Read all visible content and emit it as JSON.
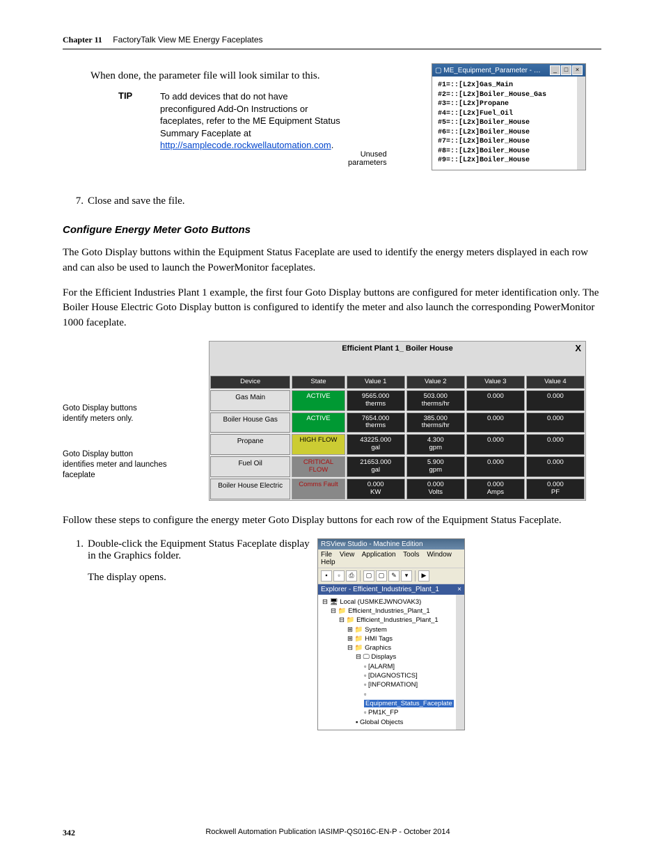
{
  "header": {
    "chapter": "Chapter 11",
    "title": "FactoryTalk View ME Energy Faceplates"
  },
  "intro": "When done, the parameter file will look similar to this.",
  "tip": {
    "label": "TIP",
    "body": "To add devices that do not have preconfigured Add-On Instructions or faceplates, refer to the ME Equipment Status Summary Faceplate at ",
    "link": "http://samplecode.rockwellautomation.com",
    "tail": "."
  },
  "unused": {
    "l1": "Unused",
    "l2": "parameters"
  },
  "param_window": {
    "title": "ME_Equipment_Parameter - …",
    "lines": [
      "#1=::[L2x]Gas_Main",
      "#2=::[L2x]Boiler_House_Gas",
      "#3=::[L2x]Propane",
      "#4=::[L2x]Fuel_Oil",
      "#5=::[L2x]Boiler_House",
      "#6=::[L2x]Boiler_House",
      "#7=::[L2x]Boiler_House",
      "#8=::[L2x]Boiler_House",
      "#9=::[L2x]Boiler_House"
    ]
  },
  "step7": {
    "num": "7.",
    "text": "Close and save the file."
  },
  "section": "Configure Energy Meter Goto Buttons",
  "para1": "The Goto Display buttons within the Equipment Status Faceplate are used to identify the energy meters displayed in each row and can also be used to launch the PowerMonitor faceplates.",
  "para2": "For the Efficient Industries Plant 1 example, the first four Goto Display buttons are configured for meter identification only. The Boiler House Electric Goto Display button is configured to identify the meter and also launch the corresponding PowerMonitor 1000 faceplate.",
  "fp_labels": {
    "g1a": "Goto Display buttons",
    "g1b": "identify meters only.",
    "g2a": "Goto Display button",
    "g2b": "identifies meter and launches",
    "g2c": "faceplate"
  },
  "fp": {
    "title": "Efficient Plant 1_ Boiler House",
    "x": "X",
    "headers": [
      "Device",
      "State",
      "Value 1",
      "Value 2",
      "Value 3",
      "Value 4"
    ],
    "rows": [
      {
        "device": "Gas Main",
        "state": "ACTIVE",
        "stateClass": "fp-state-active",
        "v1": "9565.000\ntherms",
        "v2": "503.000\ntherms/hr",
        "v3": "0.000",
        "v4": "0.000"
      },
      {
        "device": "Boiler House Gas",
        "state": "ACTIVE",
        "stateClass": "fp-state-active",
        "v1": "7654.000\ntherms",
        "v2": "385.000\ntherms/hr",
        "v3": "0.000",
        "v4": "0.000"
      },
      {
        "device": "Propane",
        "state": "HIGH FLOW",
        "stateClass": "fp-state-high",
        "v1": "43225.000\ngal",
        "v2": "4.300\ngpm",
        "v3": "0.000",
        "v4": "0.000"
      },
      {
        "device": "Fuel Oil",
        "state": "CRITICAL FLOW",
        "stateClass": "fp-state-crit",
        "v1": "21653.000\ngal",
        "v2": "5.900\ngpm",
        "v3": "0.000",
        "v4": "0.000"
      },
      {
        "device": "Boiler House Electric",
        "state": "Comms Fault",
        "stateClass": "fp-state-fault",
        "v1": "0.000\nKW",
        "v2": "0.000\nVolts",
        "v3": "0.000\nAmps",
        "v4": "0.000\nPF"
      }
    ]
  },
  "para3": "Follow these steps to configure the energy meter Goto Display buttons for each row of the Equipment Status Faceplate.",
  "step1": {
    "num": "1.",
    "text": "Double-click the Equipment Status Faceplate display in the Graphics folder.",
    "sub": "The display opens."
  },
  "rsview": {
    "title": "RSView Studio - Machine Edition",
    "menu": [
      "File",
      "View",
      "Application",
      "Tools",
      "Window",
      "Help"
    ],
    "explorer": "Explorer - Efficient_Industries_Plant_1",
    "tree": {
      "local": "Local (USMKEJWNOVAK3)",
      "proj1": "Efficient_Industries_Plant_1",
      "proj2": "Efficient_Industries_Plant_1",
      "system": "System",
      "hmi": "HMI Tags",
      "graphics": "Graphics",
      "displays": "Displays",
      "alarm": "[ALARM]",
      "diag": "[DIAGNOSTICS]",
      "info": "[INFORMATION]",
      "esf": "Equipment_Status_Faceplate",
      "pm1k": "PM1K_FP",
      "global": "Global Objects"
    }
  },
  "footer": {
    "page": "342",
    "pub": "Rockwell Automation Publication IASIMP-QS016C-EN-P - October 2014"
  }
}
